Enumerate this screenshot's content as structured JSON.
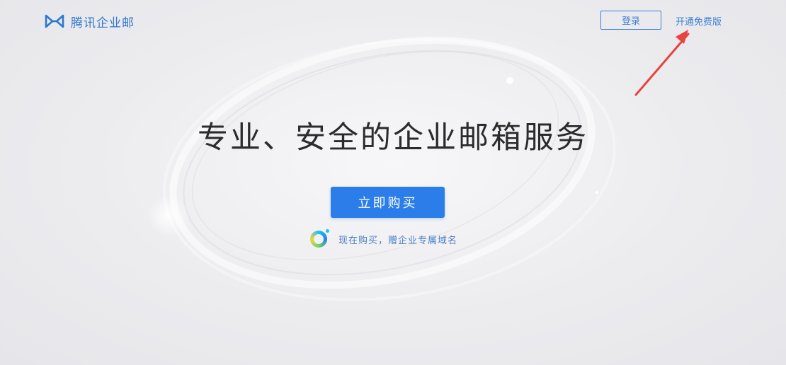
{
  "header": {
    "logo_text": "腾讯企业邮",
    "login_label": "登录",
    "trial_label": "开通免费版"
  },
  "hero": {
    "title": "专业、安全的企业邮箱服务",
    "buy_label": "立即购买",
    "promo_text": "现在购买，赠企业专属域名"
  },
  "colors": {
    "brand_blue": "#2b7de9",
    "link_blue": "#3d7fd3",
    "annotation_red": "#e8433c"
  },
  "icons": {
    "logo": "tencent-exmail-logo-icon",
    "promo": "domain-badge-icon",
    "annotation": "red-arrow-icon"
  }
}
